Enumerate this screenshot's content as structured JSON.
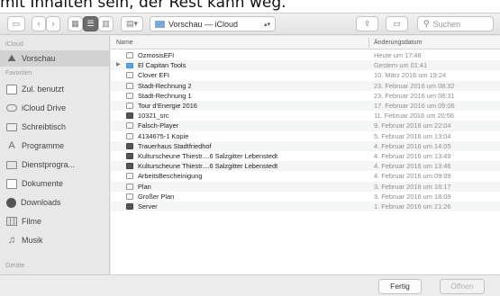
{
  "caption": {
    "text": "mit Inhalten sein, der Rest kann weg."
  },
  "toolbar": {
    "location": "Vorschau — iCloud",
    "search_placeholder": "Suchen"
  },
  "sidebar": {
    "section_icloud": "iCloud",
    "section_favorites": "Favoriten",
    "section_devices": "Geräte",
    "icloud_item": {
      "label": "Vorschau",
      "icon": "preview-app-icon"
    },
    "items": [
      {
        "label": "Zul. benutzt",
        "icon": "recents-icon"
      },
      {
        "label": "iCloud Drive",
        "icon": "cloud-icon"
      },
      {
        "label": "Schreibtisch",
        "icon": "desktop-icon"
      },
      {
        "label": "Programme",
        "icon": "applications-icon"
      },
      {
        "label": "Dienstprogra...",
        "icon": "folder-icon"
      },
      {
        "label": "Dokumente",
        "icon": "documents-icon"
      },
      {
        "label": "Downloads",
        "icon": "downloads-icon"
      },
      {
        "label": "Filme",
        "icon": "movies-icon"
      },
      {
        "label": "Musik",
        "icon": "music-icon"
      }
    ]
  },
  "columns": {
    "name": "Name",
    "date": "Änderungsdatum"
  },
  "files": [
    {
      "name": "OzmosisEFI",
      "date": "Heute um 17:48",
      "kind": "doc"
    },
    {
      "name": "El Capitan Tools",
      "date": "Gestern um 01:41",
      "kind": "folder"
    },
    {
      "name": "Clover EFI",
      "date": "10. März 2016 um 19:24",
      "kind": "doc"
    },
    {
      "name": "Stadt-Rechnung 2",
      "date": "23. Februar 2016 um 08:32",
      "kind": "doc"
    },
    {
      "name": "Stadt-Rechnung 1",
      "date": "23. Februar 2016 um 08:31",
      "kind": "doc"
    },
    {
      "name": "Tour d'Energie 2016",
      "date": "17. Februar 2016 um 09:06",
      "kind": "doc"
    },
    {
      "name": "10321_src",
      "date": "11. Februar 2016 um 20:56",
      "kind": "dark"
    },
    {
      "name": "Falsch-Player",
      "date": "9. Februar 2016 um 22:04",
      "kind": "doc"
    },
    {
      "name": "4134675-1 Kopie",
      "date": "5. Februar 2016 um 13:04",
      "kind": "doc"
    },
    {
      "name": "Trauerhaus Stadtfriedhof",
      "date": "4. Februar 2016 um 14:05",
      "kind": "dark"
    },
    {
      "name": "Kulturscheune Thiestr....6 Salzgitter Lebenstedt",
      "date": "4. Februar 2016 um 13:49",
      "kind": "dark"
    },
    {
      "name": "Kulturscheune Thiestr....6 Salzgitter Lebenstedt",
      "date": "4. Februar 2016 um 13:46",
      "kind": "dark"
    },
    {
      "name": "ArbeitsBescheinigung",
      "date": "4. Februar 2016 um 09:09",
      "kind": "doc"
    },
    {
      "name": "Plan",
      "date": "3. Februar 2016 um 18:17",
      "kind": "doc"
    },
    {
      "name": "Großer Plan",
      "date": "3. Februar 2016 um 18:09",
      "kind": "doc"
    },
    {
      "name": "Server",
      "date": "1. Februar 2016 um 21:26",
      "kind": "dark"
    }
  ],
  "buttons": {
    "done": "Fertig",
    "open": "Öffnen"
  }
}
